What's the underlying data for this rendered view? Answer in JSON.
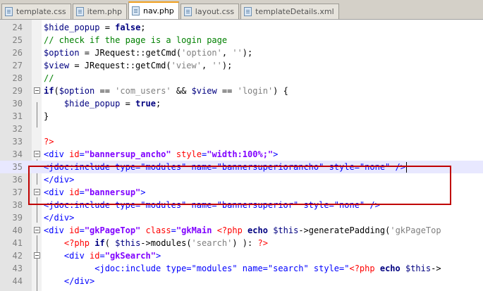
{
  "tabs": [
    {
      "label": "template.css",
      "active": false
    },
    {
      "label": "item.php",
      "active": false
    },
    {
      "label": "nav.php",
      "active": true
    },
    {
      "label": "layout.css",
      "active": false
    },
    {
      "label": "templateDetails.xml",
      "active": false
    }
  ],
  "colors": {
    "tag": "#0000ff",
    "attribute": "#ff0000",
    "string": "#8000ff",
    "comment": "#008000",
    "keyword": "#000080",
    "highlight_box": "#c00000"
  },
  "lines": [
    {
      "num": "24",
      "fold": false,
      "tokens": [
        [
          "var",
          "$hide_popup"
        ],
        [
          "plain",
          " = "
        ],
        [
          "kw",
          "false"
        ],
        [
          "plain",
          ";"
        ]
      ]
    },
    {
      "num": "25",
      "fold": false,
      "tokens": [
        [
          "com",
          "// check if the page is a login page"
        ]
      ]
    },
    {
      "num": "26",
      "fold": false,
      "tokens": [
        [
          "var",
          "$option"
        ],
        [
          "plain",
          " = JRequest::getCmd("
        ],
        [
          "pstr",
          "'option'"
        ],
        [
          "plain",
          ", "
        ],
        [
          "pstr",
          "''"
        ],
        [
          "plain",
          ");"
        ]
      ]
    },
    {
      "num": "27",
      "fold": false,
      "tokens": [
        [
          "var",
          "$view"
        ],
        [
          "plain",
          " = JRequest::getCmd("
        ],
        [
          "pstr",
          "'view'"
        ],
        [
          "plain",
          ", "
        ],
        [
          "pstr",
          "''"
        ],
        [
          "plain",
          ");"
        ]
      ]
    },
    {
      "num": "28",
      "fold": false,
      "tokens": [
        [
          "com",
          "//"
        ]
      ]
    },
    {
      "num": "29",
      "fold": true,
      "tokens": [
        [
          "kw",
          "if"
        ],
        [
          "plain",
          "("
        ],
        [
          "var",
          "$option"
        ],
        [
          "plain",
          " == "
        ],
        [
          "pstr",
          "'com_users'"
        ],
        [
          "plain",
          " && "
        ],
        [
          "var",
          "$view"
        ],
        [
          "plain",
          " == "
        ],
        [
          "pstr",
          "'login'"
        ],
        [
          "plain",
          ") {"
        ]
      ]
    },
    {
      "num": "30",
      "fold": false,
      "tokens": [
        [
          "plain",
          "    "
        ],
        [
          "var",
          "$hide_popup"
        ],
        [
          "plain",
          " = "
        ],
        [
          "kw",
          "true"
        ],
        [
          "plain",
          ";"
        ]
      ]
    },
    {
      "num": "31",
      "fold": false,
      "tokens": [
        [
          "plain",
          "}"
        ]
      ]
    },
    {
      "num": "32",
      "fold": false,
      "tokens": []
    },
    {
      "num": "33",
      "fold": false,
      "tokens": [
        [
          "php",
          "?>"
        ]
      ]
    },
    {
      "num": "34",
      "fold": true,
      "tokens": [
        [
          "tag",
          "<div "
        ],
        [
          "attr",
          "id"
        ],
        [
          "tag",
          "="
        ],
        [
          "str",
          "\"bannersup_ancho\""
        ],
        [
          "tag",
          " "
        ],
        [
          "attr",
          "style"
        ],
        [
          "tag",
          "="
        ],
        [
          "str",
          "\"width:100%;\""
        ],
        [
          "tag",
          ">"
        ]
      ]
    },
    {
      "num": "35",
      "fold": false,
      "current": true,
      "tokens": [
        [
          "tag",
          "<jdoc:include type=\"modules\" name=\"bannersuperiorancho\" style=\"none\" />"
        ]
      ]
    },
    {
      "num": "36",
      "fold": false,
      "tokens": [
        [
          "tag",
          "</div>"
        ]
      ]
    },
    {
      "num": "37",
      "fold": true,
      "tokens": [
        [
          "tag",
          "<div "
        ],
        [
          "attr",
          "id"
        ],
        [
          "tag",
          "="
        ],
        [
          "str",
          "\"bannersup\""
        ],
        [
          "tag",
          ">"
        ]
      ]
    },
    {
      "num": "38",
      "fold": false,
      "tokens": [
        [
          "tag",
          "<jdoc:include type=\"modules\" name=\"bannersuperior\" style=\"none\" />"
        ]
      ]
    },
    {
      "num": "39",
      "fold": false,
      "tokens": [
        [
          "tag",
          "</div>"
        ]
      ]
    },
    {
      "num": "40",
      "fold": true,
      "tokens": [
        [
          "tag",
          "<div "
        ],
        [
          "attr",
          "id"
        ],
        [
          "tag",
          "="
        ],
        [
          "str",
          "\"gkPageTop\""
        ],
        [
          "tag",
          " "
        ],
        [
          "attr",
          "class"
        ],
        [
          "tag",
          "="
        ],
        [
          "str",
          "\"gkMain "
        ],
        [
          "php",
          "<?php"
        ],
        [
          "plain",
          " "
        ],
        [
          "kw",
          "echo"
        ],
        [
          "plain",
          " "
        ],
        [
          "var",
          "$this"
        ],
        [
          "plain",
          "->generatePadding("
        ],
        [
          "pstr",
          "'gkPageTop"
        ]
      ]
    },
    {
      "num": "41",
      "fold": false,
      "tokens": [
        [
          "plain",
          "    "
        ],
        [
          "php",
          "<?php"
        ],
        [
          "plain",
          " "
        ],
        [
          "kw",
          "if"
        ],
        [
          "plain",
          "( "
        ],
        [
          "var",
          "$this"
        ],
        [
          "plain",
          "->modules("
        ],
        [
          "pstr",
          "'search'"
        ],
        [
          "plain",
          ") ): "
        ],
        [
          "php",
          "?>"
        ]
      ]
    },
    {
      "num": "42",
      "fold": true,
      "tokens": [
        [
          "plain",
          "    "
        ],
        [
          "tag",
          "<div "
        ],
        [
          "attr",
          "id"
        ],
        [
          "tag",
          "="
        ],
        [
          "str",
          "\"gkSearch\""
        ],
        [
          "tag",
          ">"
        ]
      ]
    },
    {
      "num": "43",
      "fold": false,
      "tokens": [
        [
          "plain",
          "          "
        ],
        [
          "tag",
          "<jdoc:include type=\"modules\" name=\"search\" style=\""
        ],
        [
          "php",
          "<?php"
        ],
        [
          "plain",
          " "
        ],
        [
          "kw",
          "echo"
        ],
        [
          "plain",
          " "
        ],
        [
          "var",
          "$this"
        ],
        [
          "plain",
          "->"
        ]
      ]
    },
    {
      "num": "44",
      "fold": false,
      "tokens": [
        [
          "plain",
          "    "
        ],
        [
          "tag",
          "</div>"
        ]
      ]
    }
  ]
}
